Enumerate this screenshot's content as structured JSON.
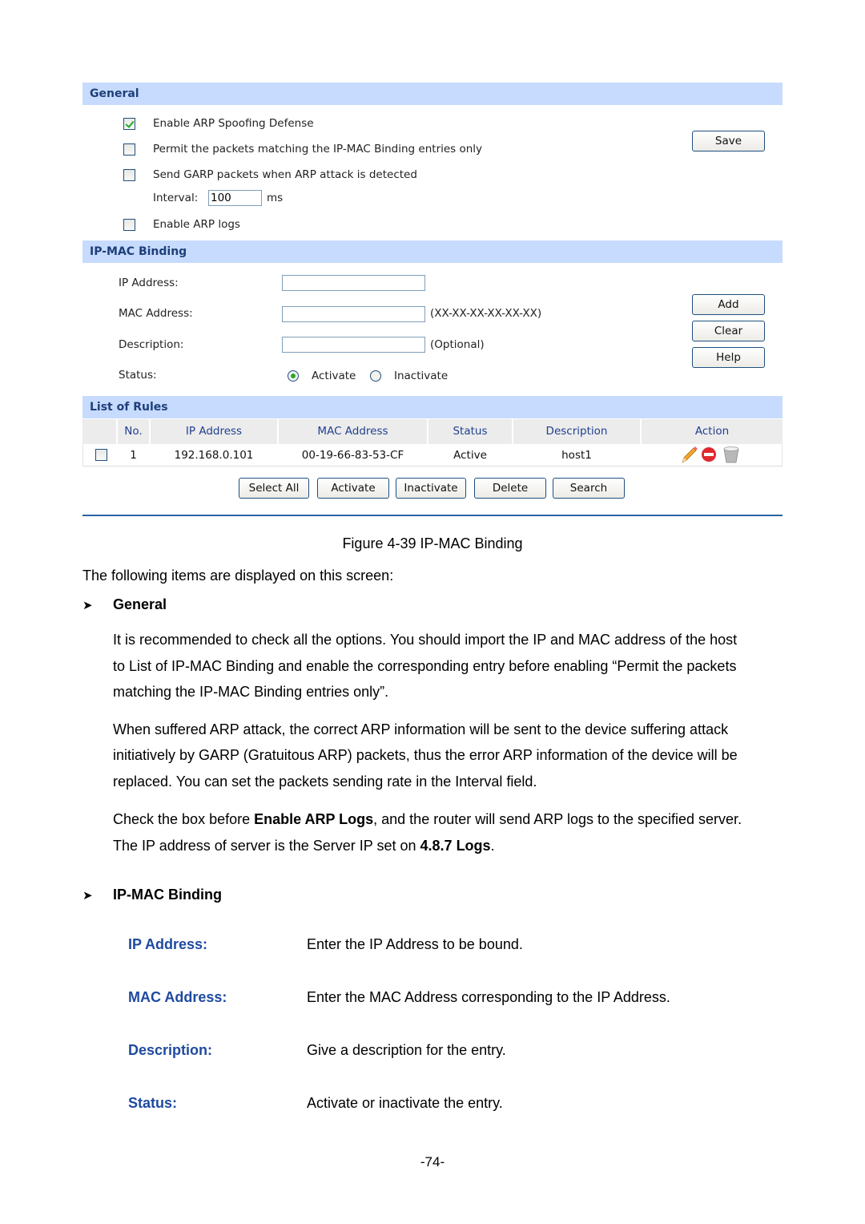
{
  "general": {
    "header": "General",
    "options": [
      {
        "label": "Enable ARP Spoofing Defense",
        "checked": true
      },
      {
        "label": "Permit the packets matching the IP-MAC Binding entries only",
        "checked": false
      },
      {
        "label": "Send GARP packets when ARP attack is detected",
        "checked": false
      },
      {
        "label": "Enable ARP logs",
        "checked": false
      }
    ],
    "interval_label": "Interval:",
    "interval_value": "100",
    "interval_unit": "ms",
    "save_label": "Save"
  },
  "binding": {
    "header": "IP-MAC Binding",
    "ip_label": "IP Address:",
    "ip_value": "",
    "mac_label": "MAC Address:",
    "mac_value": "",
    "mac_hint": "(XX-XX-XX-XX-XX-XX)",
    "desc_label": "Description:",
    "desc_value": "",
    "desc_hint": "(Optional)",
    "status_label": "Status:",
    "status_options": [
      "Activate",
      "Inactivate"
    ],
    "status_selected": "Activate",
    "add_label": "Add",
    "clear_label": "Clear",
    "help_label": "Help"
  },
  "rules": {
    "header": "List of Rules",
    "columns": [
      "No.",
      "IP Address",
      "MAC Address",
      "Status",
      "Description",
      "Action"
    ],
    "rows": [
      {
        "no": "1",
        "ip": "192.168.0.101",
        "mac": "00-19-66-83-53-CF",
        "status": "Active",
        "description": "host1",
        "actions": [
          "edit-icon",
          "disable-icon",
          "delete-icon"
        ]
      }
    ],
    "buttons": [
      "Select All",
      "Activate",
      "Inactivate",
      "Delete",
      "Search"
    ]
  },
  "document": {
    "caption": "Figure 4-39 IP-MAC Binding",
    "intro": "The following items are displayed on this screen:",
    "section1_title": "General",
    "para1": [
      "It is recommended to check all the options. You should import the IP and MAC address of the host",
      "to List of IP-MAC Binding and enable the corresponding entry before enabling “Permit the packets",
      "matching the IP-MAC Binding entries only”."
    ],
    "para2": [
      "When suffered ARP attack, the correct ARP information will be sent to the device suffering attack",
      "initiatively by GARP (Gratuitous ARP) packets, thus the error ARP information of the device will be",
      "replaced. You can set the packets sending rate in the Interval field."
    ],
    "para3_a": "Check the box before ",
    "para3_b": "Enable ARP Logs",
    "para3_c": ", and the router will send ARP logs to the specified server.",
    "para3_d": "The IP address of server is the Server IP set on ",
    "para3_e": "4.8.7 Logs",
    "para3_f": ".",
    "section2_title": "IP-MAC Binding",
    "terms": [
      {
        "term": "IP Address:",
        "def": "Enter the IP Address to be bound."
      },
      {
        "term": "MAC Address:",
        "def": "Enter the MAC Address corresponding to the IP Address."
      },
      {
        "term": "Description:",
        "def": "Give a description for the entry."
      },
      {
        "term": "Status:",
        "def": "Activate or inactivate the entry."
      }
    ],
    "page_number": "-74-"
  }
}
